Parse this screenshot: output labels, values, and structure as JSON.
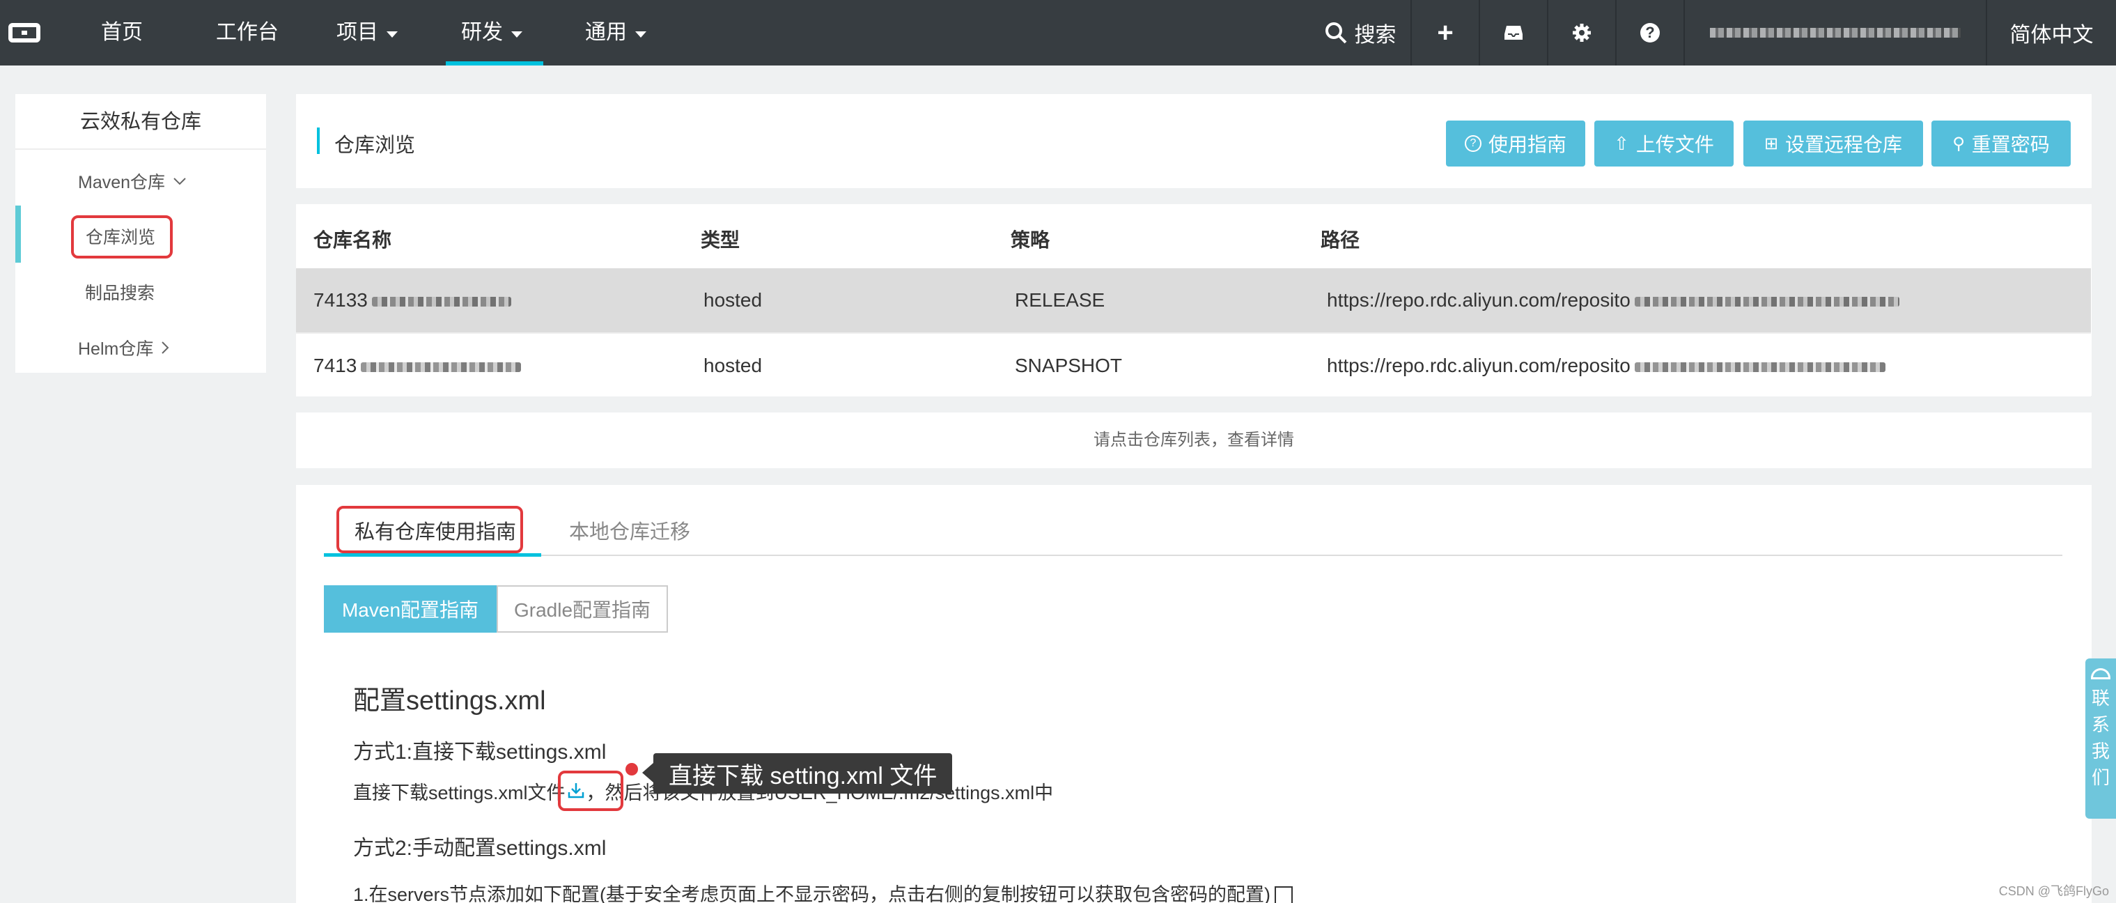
{
  "topbar": {
    "nav": [
      "首页",
      "工作台",
      "项目",
      "研发",
      "通用"
    ],
    "search": "搜索",
    "user": "●●●●●●●●●●●●●●●●●●●●",
    "lang": "简体中文"
  },
  "sidebar": {
    "title": "云效私有仓库",
    "maven": "Maven仓库",
    "browse": "仓库浏览",
    "search": "制品搜索",
    "helm": "Helm仓库"
  },
  "header": {
    "title": "仓库浏览",
    "buttons": [
      "使用指南",
      "上传文件",
      "设置远程仓库",
      "重置密码"
    ]
  },
  "table": {
    "columns": [
      "仓库名称",
      "类型",
      "策略",
      "路径"
    ],
    "rows": [
      {
        "name": "74133",
        "type": "hosted",
        "policy": "RELEASE",
        "path": "https://repo.rdc.aliyun.com/reposito"
      },
      {
        "name": "7413",
        "type": "hosted",
        "policy": "SNAPSHOT",
        "path": "https://repo.rdc.aliyun.com/reposito"
      }
    ]
  },
  "notice": "请点击仓库列表，查看详情",
  "guide": {
    "tabs": [
      "私有仓库使用指南",
      "本地仓库迁移"
    ],
    "seg": [
      "Maven配置指南",
      "Gradle配置指南"
    ],
    "h2": "配置settings.xml",
    "way1": "方式1:直接下载settings.xml",
    "way1_desc_a": "直接下载settings.xml文件",
    "way1_desc_b": "，然后将该文件放置到USER_HOME/.m2/settings.xml中",
    "way2": "方式2:手动配置settings.xml",
    "step1": "1.在servers节点添加如下配置(基于安全考虑页面上不显示密码，点击右侧的复制按钮可以获取包含密码的配置)",
    "tooltip": "直接下载 setting.xml 文件"
  },
  "contact": [
    "联",
    "系",
    "我",
    "们"
  ],
  "watermark": "CSDN @飞鸽FlyGo"
}
